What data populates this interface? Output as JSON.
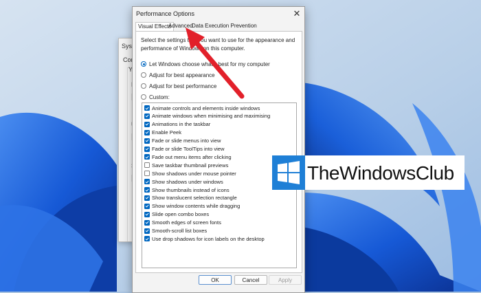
{
  "background_window": {
    "title_fragment": "Syste",
    "tab_fragment": "Com",
    "line1": "Yo",
    "line2": "P",
    "line3": "U",
    "line4": "S"
  },
  "dialog": {
    "title": "Performance Options",
    "close_glyph": "✕",
    "tabs": [
      "Visual Effects",
      "Advanced",
      "Data Execution Prevention"
    ],
    "active_tab": "Visual Effects",
    "description": "Select the settings that you want to use for the appearance and performance of Windows on this computer.",
    "radio_options": [
      {
        "label": "Let Windows choose what's best for my computer",
        "selected": true
      },
      {
        "label": "Adjust for best appearance",
        "selected": false
      },
      {
        "label": "Adjust for best performance",
        "selected": false
      },
      {
        "label": "Custom:",
        "selected": false
      }
    ],
    "effects": [
      {
        "label": "Animate controls and elements inside windows",
        "checked": true
      },
      {
        "label": "Animate windows when minimising and maximising",
        "checked": true
      },
      {
        "label": "Animations in the taskbar",
        "checked": true
      },
      {
        "label": "Enable Peek",
        "checked": true
      },
      {
        "label": "Fade or slide menus into view",
        "checked": true
      },
      {
        "label": "Fade or slide ToolTips into view",
        "checked": true
      },
      {
        "label": "Fade out menu items after clicking",
        "checked": true
      },
      {
        "label": "Save taskbar thumbnail previews",
        "checked": false
      },
      {
        "label": "Show shadows under mouse pointer",
        "checked": false
      },
      {
        "label": "Show shadows under windows",
        "checked": true
      },
      {
        "label": "Show thumbnails instead of icons",
        "checked": true
      },
      {
        "label": "Show translucent selection rectangle",
        "checked": true
      },
      {
        "label": "Show window contents while dragging",
        "checked": true
      },
      {
        "label": "Slide open combo boxes",
        "checked": true
      },
      {
        "label": "Smooth edges of screen fonts",
        "checked": true
      },
      {
        "label": "Smooth-scroll list boxes",
        "checked": true
      },
      {
        "label": "Use drop shadows for icon labels on the desktop",
        "checked": true
      }
    ],
    "buttons": {
      "ok": "OK",
      "cancel": "Cancel",
      "apply": "Apply"
    }
  },
  "watermark": {
    "text": "TheWindowsClub",
    "logo_colors": [
      "#1e7fd6",
      "#0f5ea8"
    ]
  },
  "annotation": {
    "arrow_color": "#e2202a",
    "points_to": "Advanced"
  },
  "colors": {
    "accent": "#0067c0",
    "dialog_bg": "#f3f3f3"
  }
}
